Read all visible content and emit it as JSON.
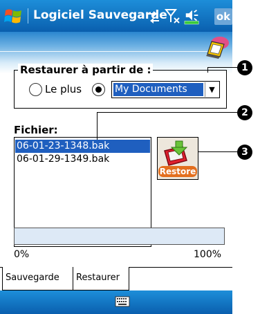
{
  "titlebar": {
    "title": "Logiciel Sauvegarde",
    "ok_label": "ok"
  },
  "restore_from": {
    "label": "Restaurer à partir de :",
    "radio_latest_label": "Le plus",
    "radio_latest_selected": false,
    "radio_folder_selected": true,
    "combo_value": "My Documents"
  },
  "file_list": {
    "label": "Fichier:",
    "files": [
      {
        "name": "06-01-23-1348.bak",
        "selected": true
      },
      {
        "name": "06-01-29-1349.bak",
        "selected": false
      }
    ]
  },
  "restore_button": {
    "label": "Restore"
  },
  "progress": {
    "value_percent": 0,
    "min_label": "0%",
    "max_label": "100%"
  },
  "tabs": [
    {
      "label": "Sauvegarde",
      "active": false
    },
    {
      "label": "Restaurer",
      "active": true
    }
  ],
  "callouts": [
    "1",
    "2",
    "3"
  ],
  "icons": {
    "start": "windows-flag-icon",
    "connectivity": "connectivity-icon",
    "signal": "signal-icon",
    "volume": "volume-icon",
    "app": "backup-app-icon",
    "keyboard": "keyboard-icon"
  },
  "colors": {
    "titlebar": "#0a5fae",
    "selection": "#1f5fbf",
    "restore_badge": "#e36f1e"
  }
}
